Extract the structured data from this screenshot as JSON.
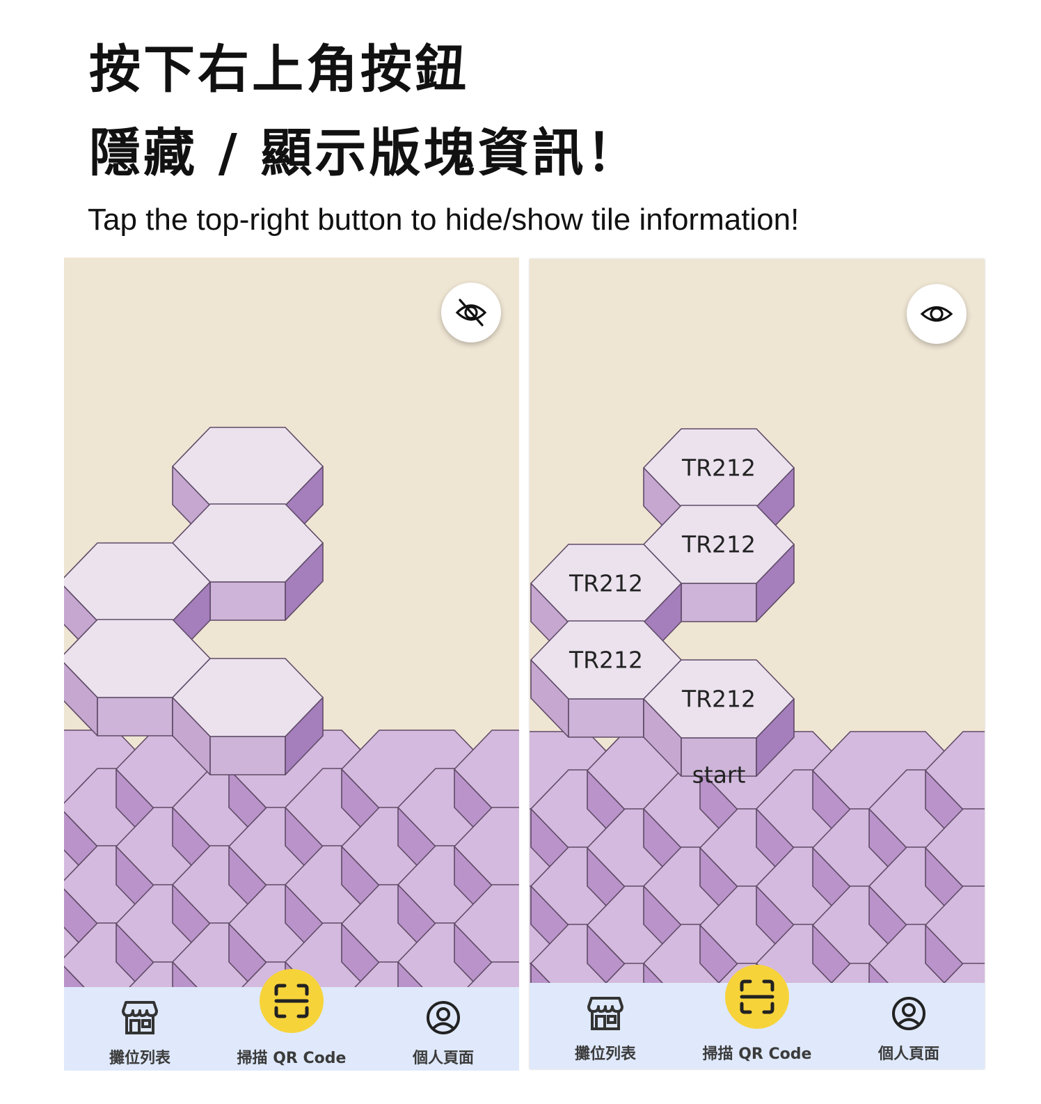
{
  "heading": {
    "line1": "按下右上角按鈕",
    "line2": "隱藏 / 顯示版塊資訊！",
    "subtitle": "Tap the top-right button to hide/show tile information!"
  },
  "colors": {
    "board_background": "#efe5d3",
    "tile_top": "#ebe2ee",
    "tile_side_light": "#c5a7d0",
    "tile_side_dark": "#a57ebc",
    "ground_top": "#d4bade",
    "ground_side": "#b993c9",
    "nav_background": "#dfe9fb",
    "scan_button": "#f7d33a"
  },
  "panels": [
    {
      "id": "info-hidden",
      "toggle_icon": "eye-off-icon",
      "tiles": [
        {
          "label": ""
        },
        {
          "label": ""
        },
        {
          "label": ""
        },
        {
          "label": ""
        },
        {
          "label": ""
        }
      ],
      "start_label": "",
      "nav": [
        {
          "icon": "storefront-icon",
          "label": "攤位列表"
        },
        {
          "icon": "qr-scan-icon",
          "label": "掃描 QR Code"
        },
        {
          "icon": "profile-icon",
          "label": "個人頁面"
        }
      ]
    },
    {
      "id": "info-shown",
      "toggle_icon": "eye-icon",
      "tiles": [
        {
          "label": "TR212"
        },
        {
          "label": "TR212"
        },
        {
          "label": "TR212"
        },
        {
          "label": "TR212"
        },
        {
          "label": "TR212"
        }
      ],
      "start_label": "start",
      "nav": [
        {
          "icon": "storefront-icon",
          "label": "攤位列表"
        },
        {
          "icon": "qr-scan-icon",
          "label": "掃描 QR Code"
        },
        {
          "icon": "profile-icon",
          "label": "個人頁面"
        }
      ]
    }
  ]
}
